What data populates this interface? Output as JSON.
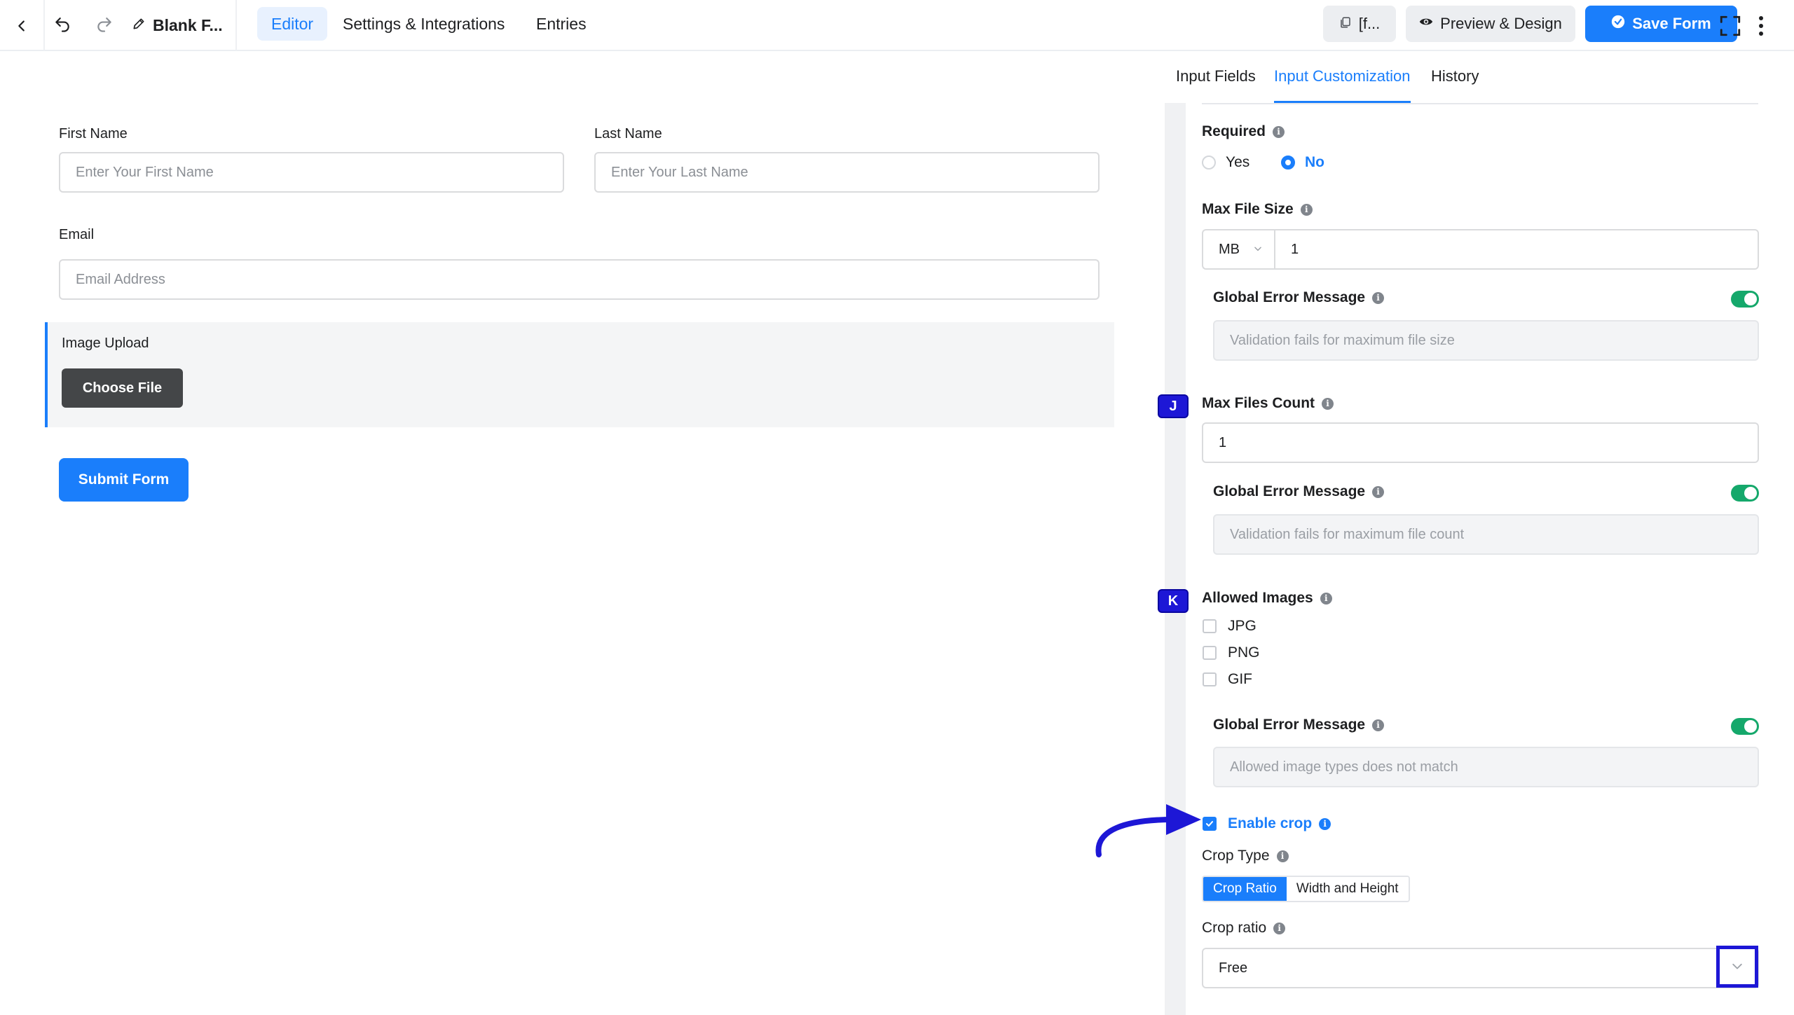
{
  "topbar": {
    "form_title": "Blank F...",
    "tabs": [
      {
        "label": "Editor",
        "active": true
      },
      {
        "label": "Settings & Integrations",
        "active": false
      },
      {
        "label": "Entries",
        "active": false
      }
    ],
    "shortcode_label": "[f...",
    "preview_label": "Preview & Design",
    "save_label": "Save Form"
  },
  "form": {
    "first_name": {
      "label": "First Name",
      "placeholder": "Enter Your First Name"
    },
    "last_name": {
      "label": "Last Name",
      "placeholder": "Enter Your Last Name"
    },
    "email": {
      "label": "Email",
      "placeholder": "Email Address"
    },
    "image_upload": {
      "label": "Image Upload",
      "button": "Choose File"
    },
    "submit_label": "Submit Form"
  },
  "panel": {
    "tabs": [
      {
        "label": "Input Fields",
        "active": false
      },
      {
        "label": "Input Customization",
        "active": true
      },
      {
        "label": "History",
        "active": false
      }
    ],
    "required": {
      "label": "Required",
      "options": [
        "Yes",
        "No"
      ],
      "selected": "No"
    },
    "max_file_size": {
      "label": "Max File Size",
      "unit": "MB",
      "value": "1"
    },
    "file_size_error": {
      "label": "Global Error Message",
      "enabled": true,
      "placeholder": "Validation fails for maximum file size"
    },
    "max_files_count": {
      "label": "Max Files Count",
      "value": "1"
    },
    "files_count_error": {
      "label": "Global Error Message",
      "enabled": true,
      "placeholder": "Validation fails for maximum file count"
    },
    "allowed_images": {
      "label": "Allowed Images",
      "options": [
        "JPG",
        "PNG",
        "GIF"
      ],
      "checked": []
    },
    "image_types_error": {
      "label": "Global Error Message",
      "enabled": true,
      "placeholder": "Allowed image types does not match"
    },
    "enable_crop": {
      "label": "Enable crop",
      "checked": true
    },
    "crop_type": {
      "label": "Crop Type",
      "options": [
        "Crop Ratio",
        "Width and Height"
      ],
      "selected": "Crop Ratio"
    },
    "crop_ratio": {
      "label": "Crop ratio",
      "value": "Free"
    }
  },
  "annotations": {
    "marker_j": "J",
    "marker_k": "K"
  },
  "colors": {
    "accent": "#1a7efb",
    "toggle_on": "#15a86b",
    "annotation": "#1d17d6"
  }
}
